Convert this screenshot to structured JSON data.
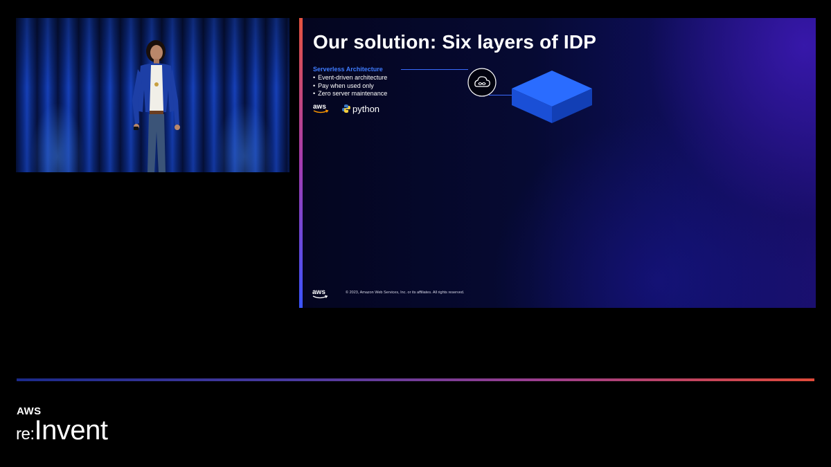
{
  "slide": {
    "title": "Our solution: Six layers of IDP",
    "section_heading": "Serverless Architecture",
    "bullets": [
      "Event-driven architecture",
      "Pay when used only",
      "Zero server maintenance"
    ],
    "logos": {
      "aws": "aws",
      "python": "python"
    },
    "copyright": "© 2023, Amazon Web Services, Inc. or its affiliates. All rights reserved.",
    "icons": {
      "serverless": "cloud-infinity-icon",
      "layer": "isometric-layer-block"
    },
    "colors": {
      "accent_blue": "#3f7cff",
      "layer_blue": "#1f63ff"
    }
  },
  "brand": {
    "aws": "AWS",
    "re": "re:",
    "invent": "Invent"
  }
}
